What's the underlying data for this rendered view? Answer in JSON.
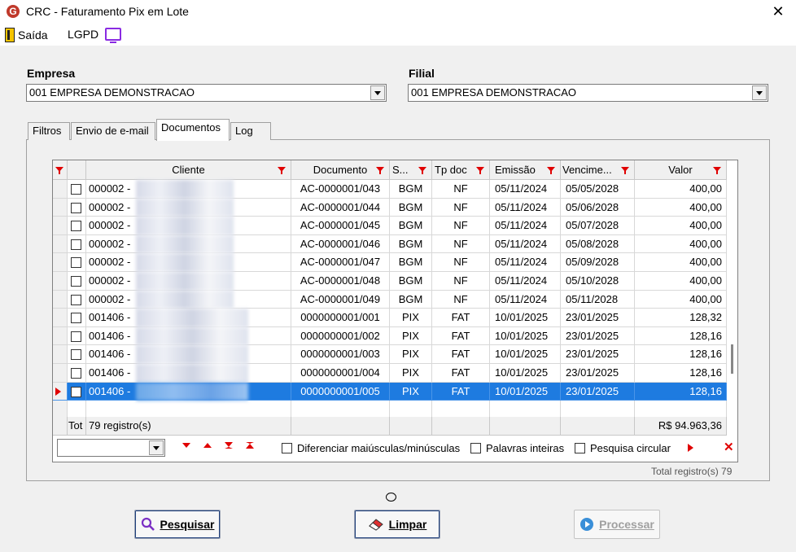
{
  "window": {
    "title": "CRC - Faturamento Pix em Lote",
    "logo_letter": "G",
    "close_glyph": "✕"
  },
  "menu": {
    "exit_label": "Saída",
    "lgpd_label": "LGPD"
  },
  "empresa": {
    "label": "Empresa",
    "value": "001 EMPRESA DEMONSTRACAO"
  },
  "filial": {
    "label": "Filial",
    "value": "001 EMPRESA DEMONSTRACAO"
  },
  "tabs": [
    "Filtros",
    "Envio de e-mail",
    "Documentos",
    "Log"
  ],
  "active_tab": "Documentos",
  "grid": {
    "columns": [
      "Cliente",
      "Documento",
      "S...",
      "Tp doc",
      "Emissão",
      "Vencime...",
      "Valor"
    ],
    "rows": [
      {
        "cliente": "000002 -",
        "documento": "AC-0000001/043",
        "serie": "BGM",
        "tpdoc": "NF",
        "emissao": "05/11/2024",
        "vencimento": "05/05/2028",
        "valor": "400,00"
      },
      {
        "cliente": "000002 -",
        "documento": "AC-0000001/044",
        "serie": "BGM",
        "tpdoc": "NF",
        "emissao": "05/11/2024",
        "vencimento": "05/06/2028",
        "valor": "400,00"
      },
      {
        "cliente": "000002 -",
        "documento": "AC-0000001/045",
        "serie": "BGM",
        "tpdoc": "NF",
        "emissao": "05/11/2024",
        "vencimento": "05/07/2028",
        "valor": "400,00"
      },
      {
        "cliente": "000002 -",
        "documento": "AC-0000001/046",
        "serie": "BGM",
        "tpdoc": "NF",
        "emissao": "05/11/2024",
        "vencimento": "05/08/2028",
        "valor": "400,00"
      },
      {
        "cliente": "000002 -",
        "documento": "AC-0000001/047",
        "serie": "BGM",
        "tpdoc": "NF",
        "emissao": "05/11/2024",
        "vencimento": "05/09/2028",
        "valor": "400,00"
      },
      {
        "cliente": "000002 -",
        "documento": "AC-0000001/048",
        "serie": "BGM",
        "tpdoc": "NF",
        "emissao": "05/11/2024",
        "vencimento": "05/10/2028",
        "valor": "400,00"
      },
      {
        "cliente": "000002 -",
        "documento": "AC-0000001/049",
        "serie": "BGM",
        "tpdoc": "NF",
        "emissao": "05/11/2024",
        "vencimento": "05/11/2028",
        "valor": "400,00"
      },
      {
        "cliente": "001406 -",
        "documento": "0000000001/001",
        "serie": "PIX",
        "tpdoc": "FAT",
        "emissao": "10/01/2025",
        "vencimento": "23/01/2025",
        "valor": "128,32"
      },
      {
        "cliente": "001406 -",
        "documento": "0000000001/002",
        "serie": "PIX",
        "tpdoc": "FAT",
        "emissao": "10/01/2025",
        "vencimento": "23/01/2025",
        "valor": "128,16"
      },
      {
        "cliente": "001406 -",
        "documento": "0000000001/003",
        "serie": "PIX",
        "tpdoc": "FAT",
        "emissao": "10/01/2025",
        "vencimento": "23/01/2025",
        "valor": "128,16"
      },
      {
        "cliente": "001406 -",
        "documento": "0000000001/004",
        "serie": "PIX",
        "tpdoc": "FAT",
        "emissao": "10/01/2025",
        "vencimento": "23/01/2025",
        "valor": "128,16"
      },
      {
        "cliente": "001406 -",
        "documento": "0000000001/005",
        "serie": "PIX",
        "tpdoc": "FAT",
        "emissao": "10/01/2025",
        "vencimento": "23/01/2025",
        "valor": "128,16",
        "selected": true
      }
    ],
    "total_label": "Tot",
    "total_records": "79 registro(s)",
    "total_value": "R$ 94.963,36"
  },
  "search": {
    "diff_case_label": "Diferenciar maiúsculas/minúsculas",
    "whole_words_label": "Palavras inteiras",
    "circular_label": "Pesquisa circular"
  },
  "total_registros": "Total registro(s) 79",
  "buttons": {
    "pesquisar": "Pesquisar",
    "limpar": "Limpar",
    "processar": "Processar"
  }
}
